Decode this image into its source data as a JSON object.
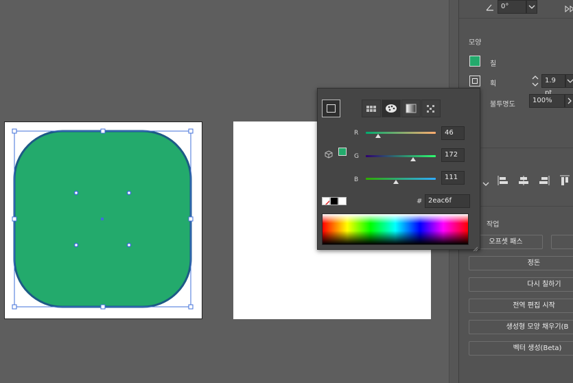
{
  "transform": {
    "angle_value": "0°"
  },
  "appearance": {
    "section_title": "모양",
    "fill_label": "칠",
    "stroke_label": "획",
    "stroke_weight": "1.9 pt",
    "opacity_label": "불투명도",
    "opacity_value": "100%",
    "fill_color": "#2eac6f"
  },
  "color_picker": {
    "r_label": "R",
    "r_value": "46",
    "g_label": "G",
    "g_value": "172",
    "b_label": "B",
    "b_value": "111",
    "hex_symbol": "#",
    "hex_value": "2eac6f"
  },
  "quick_actions": {
    "section_title": "작업",
    "offset_path": "오프셋 패스",
    "arrange": "정돈",
    "recolor": "다시 칠하기",
    "global_edit": "전역 편집 시작",
    "gen_shape_fill": "생성형 모양 채우기(B",
    "vector_gen": "벡터 생성(Beta)"
  },
  "colors": {
    "shape_fill": "#23aa6c",
    "shape_stroke": "#1d5a86",
    "selection": "#3f6fd8",
    "panel_bg": "#535353"
  }
}
